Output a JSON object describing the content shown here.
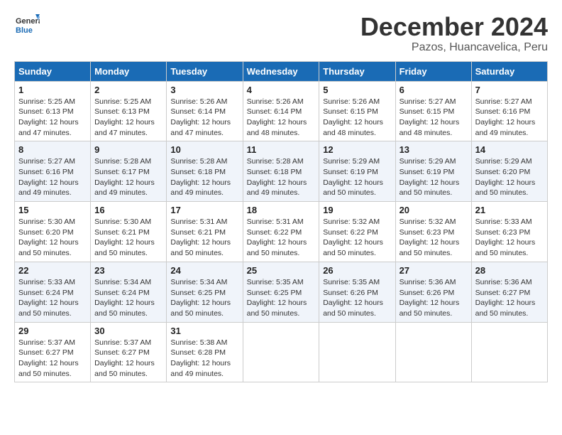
{
  "logo": {
    "line1": "General",
    "line2": "Blue"
  },
  "title": "December 2024",
  "subtitle": "Pazos, Huancavelica, Peru",
  "days_of_week": [
    "Sunday",
    "Monday",
    "Tuesday",
    "Wednesday",
    "Thursday",
    "Friday",
    "Saturday"
  ],
  "weeks": [
    [
      {
        "day": "1",
        "sunrise": "5:25 AM",
        "sunset": "6:13 PM",
        "daylight": "12 hours and 47 minutes."
      },
      {
        "day": "2",
        "sunrise": "5:25 AM",
        "sunset": "6:13 PM",
        "daylight": "12 hours and 47 minutes."
      },
      {
        "day": "3",
        "sunrise": "5:26 AM",
        "sunset": "6:14 PM",
        "daylight": "12 hours and 47 minutes."
      },
      {
        "day": "4",
        "sunrise": "5:26 AM",
        "sunset": "6:14 PM",
        "daylight": "12 hours and 48 minutes."
      },
      {
        "day": "5",
        "sunrise": "5:26 AM",
        "sunset": "6:15 PM",
        "daylight": "12 hours and 48 minutes."
      },
      {
        "day": "6",
        "sunrise": "5:27 AM",
        "sunset": "6:15 PM",
        "daylight": "12 hours and 48 minutes."
      },
      {
        "day": "7",
        "sunrise": "5:27 AM",
        "sunset": "6:16 PM",
        "daylight": "12 hours and 49 minutes."
      }
    ],
    [
      {
        "day": "8",
        "sunrise": "5:27 AM",
        "sunset": "6:16 PM",
        "daylight": "12 hours and 49 minutes."
      },
      {
        "day": "9",
        "sunrise": "5:28 AM",
        "sunset": "6:17 PM",
        "daylight": "12 hours and 49 minutes."
      },
      {
        "day": "10",
        "sunrise": "5:28 AM",
        "sunset": "6:18 PM",
        "daylight": "12 hours and 49 minutes."
      },
      {
        "day": "11",
        "sunrise": "5:28 AM",
        "sunset": "6:18 PM",
        "daylight": "12 hours and 49 minutes."
      },
      {
        "day": "12",
        "sunrise": "5:29 AM",
        "sunset": "6:19 PM",
        "daylight": "12 hours and 50 minutes."
      },
      {
        "day": "13",
        "sunrise": "5:29 AM",
        "sunset": "6:19 PM",
        "daylight": "12 hours and 50 minutes."
      },
      {
        "day": "14",
        "sunrise": "5:29 AM",
        "sunset": "6:20 PM",
        "daylight": "12 hours and 50 minutes."
      }
    ],
    [
      {
        "day": "15",
        "sunrise": "5:30 AM",
        "sunset": "6:20 PM",
        "daylight": "12 hours and 50 minutes."
      },
      {
        "day": "16",
        "sunrise": "5:30 AM",
        "sunset": "6:21 PM",
        "daylight": "12 hours and 50 minutes."
      },
      {
        "day": "17",
        "sunrise": "5:31 AM",
        "sunset": "6:21 PM",
        "daylight": "12 hours and 50 minutes."
      },
      {
        "day": "18",
        "sunrise": "5:31 AM",
        "sunset": "6:22 PM",
        "daylight": "12 hours and 50 minutes."
      },
      {
        "day": "19",
        "sunrise": "5:32 AM",
        "sunset": "6:22 PM",
        "daylight": "12 hours and 50 minutes."
      },
      {
        "day": "20",
        "sunrise": "5:32 AM",
        "sunset": "6:23 PM",
        "daylight": "12 hours and 50 minutes."
      },
      {
        "day": "21",
        "sunrise": "5:33 AM",
        "sunset": "6:23 PM",
        "daylight": "12 hours and 50 minutes."
      }
    ],
    [
      {
        "day": "22",
        "sunrise": "5:33 AM",
        "sunset": "6:24 PM",
        "daylight": "12 hours and 50 minutes."
      },
      {
        "day": "23",
        "sunrise": "5:34 AM",
        "sunset": "6:24 PM",
        "daylight": "12 hours and 50 minutes."
      },
      {
        "day": "24",
        "sunrise": "5:34 AM",
        "sunset": "6:25 PM",
        "daylight": "12 hours and 50 minutes."
      },
      {
        "day": "25",
        "sunrise": "5:35 AM",
        "sunset": "6:25 PM",
        "daylight": "12 hours and 50 minutes."
      },
      {
        "day": "26",
        "sunrise": "5:35 AM",
        "sunset": "6:26 PM",
        "daylight": "12 hours and 50 minutes."
      },
      {
        "day": "27",
        "sunrise": "5:36 AM",
        "sunset": "6:26 PM",
        "daylight": "12 hours and 50 minutes."
      },
      {
        "day": "28",
        "sunrise": "5:36 AM",
        "sunset": "6:27 PM",
        "daylight": "12 hours and 50 minutes."
      }
    ],
    [
      {
        "day": "29",
        "sunrise": "5:37 AM",
        "sunset": "6:27 PM",
        "daylight": "12 hours and 50 minutes."
      },
      {
        "day": "30",
        "sunrise": "5:37 AM",
        "sunset": "6:27 PM",
        "daylight": "12 hours and 50 minutes."
      },
      {
        "day": "31",
        "sunrise": "5:38 AM",
        "sunset": "6:28 PM",
        "daylight": "12 hours and 49 minutes."
      },
      null,
      null,
      null,
      null
    ]
  ],
  "labels": {
    "sunrise": "Sunrise:",
    "sunset": "Sunset:",
    "daylight": "Daylight:"
  },
  "accent_color": "#1a6bb5"
}
